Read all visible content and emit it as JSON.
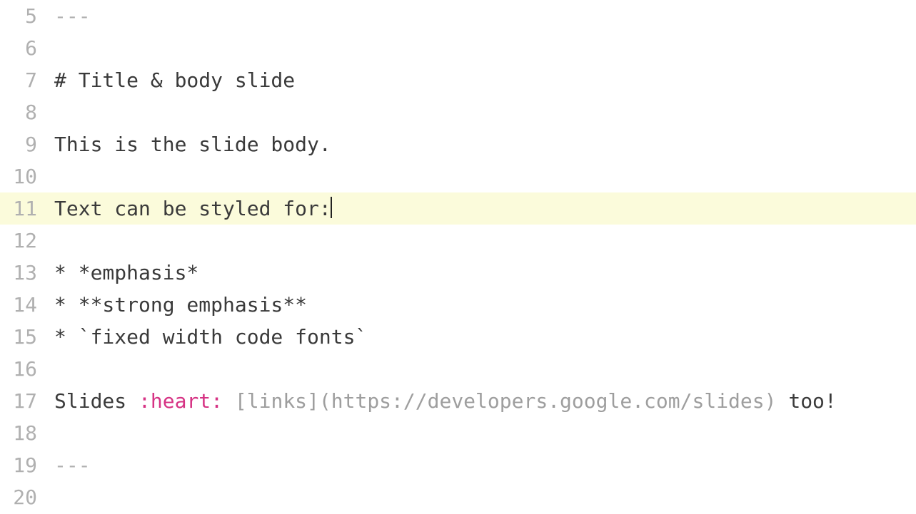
{
  "editor": {
    "startLine": 5,
    "activeLine": 11,
    "lines": [
      {
        "num": 5,
        "segments": [
          {
            "t": "---",
            "cls": "muted"
          }
        ]
      },
      {
        "num": 6,
        "segments": [
          {
            "t": "",
            "cls": ""
          }
        ]
      },
      {
        "num": 7,
        "segments": [
          {
            "t": "# Title & body slide",
            "cls": ""
          }
        ]
      },
      {
        "num": 8,
        "segments": [
          {
            "t": "",
            "cls": ""
          }
        ]
      },
      {
        "num": 9,
        "segments": [
          {
            "t": "This is the slide body.",
            "cls": ""
          }
        ]
      },
      {
        "num": 10,
        "segments": [
          {
            "t": "",
            "cls": ""
          }
        ]
      },
      {
        "num": 11,
        "segments": [
          {
            "t": "Text can be styled for:",
            "cls": ""
          }
        ],
        "cursor": true
      },
      {
        "num": 12,
        "segments": [
          {
            "t": "",
            "cls": ""
          }
        ]
      },
      {
        "num": 13,
        "segments": [
          {
            "t": "* *emphasis*",
            "cls": ""
          }
        ]
      },
      {
        "num": 14,
        "segments": [
          {
            "t": "* **strong emphasis**",
            "cls": ""
          }
        ]
      },
      {
        "num": 15,
        "segments": [
          {
            "t": "* `fixed width code fonts`",
            "cls": ""
          }
        ]
      },
      {
        "num": 16,
        "segments": [
          {
            "t": "",
            "cls": ""
          }
        ]
      },
      {
        "num": 17,
        "segments": [
          {
            "t": "Slides ",
            "cls": ""
          },
          {
            "t": ":heart:",
            "cls": "emoji"
          },
          {
            "t": " ",
            "cls": ""
          },
          {
            "t": "[links](https://developers.google.com/slides)",
            "cls": "linkish"
          },
          {
            "t": " too!",
            "cls": ""
          }
        ]
      },
      {
        "num": 18,
        "segments": [
          {
            "t": "",
            "cls": ""
          }
        ]
      },
      {
        "num": 19,
        "segments": [
          {
            "t": "---",
            "cls": "muted"
          }
        ]
      },
      {
        "num": 20,
        "segments": [
          {
            "t": "",
            "cls": ""
          }
        ]
      }
    ]
  }
}
